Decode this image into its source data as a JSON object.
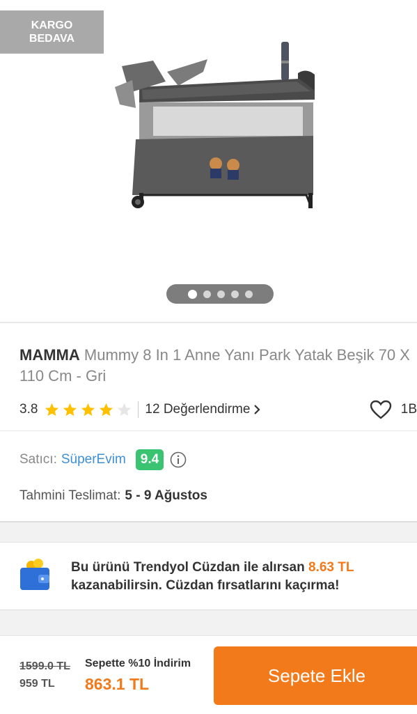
{
  "hero": {
    "badge_line1": "KARGO",
    "badge_line2": "BEDAVA",
    "image_description": "playard-crib-icon",
    "carousel_dots": 5,
    "carousel_active": 0
  },
  "product": {
    "brand": "MAMMA",
    "name": "Mummy 8 In 1 Anne Yanı Park Yatak Beşik 70 X 110 Cm - Gri",
    "rating": "3.8",
    "rating_value": 3.8,
    "reviews_label": "12 Değerlendirme",
    "favorites_count": "1B"
  },
  "seller": {
    "label": "Satıcı:",
    "name": "SüperEvim",
    "score": "9.4"
  },
  "delivery": {
    "label": "Tahmini Teslimat:",
    "value": "5 - 9 Ağustos"
  },
  "wallet": {
    "text_before": "Bu ürünü Trendyol Cüzdan ile alırsan ",
    "amount": "8.63 TL",
    "text_after": "kazanabilirsin. Cüzdan fırsatlarını kaçırma!"
  },
  "bottom": {
    "old_price": "1599.0 TL",
    "prev_price": "959 TL",
    "promo": "Sepette %10 İndirim",
    "final_price": "863.1 TL",
    "cta_label": "Sepete Ekle"
  },
  "colors": {
    "accent": "#f27a1a",
    "seller_link": "#3d8fd6",
    "score_green": "#3ac371",
    "star": "#ffc000"
  }
}
